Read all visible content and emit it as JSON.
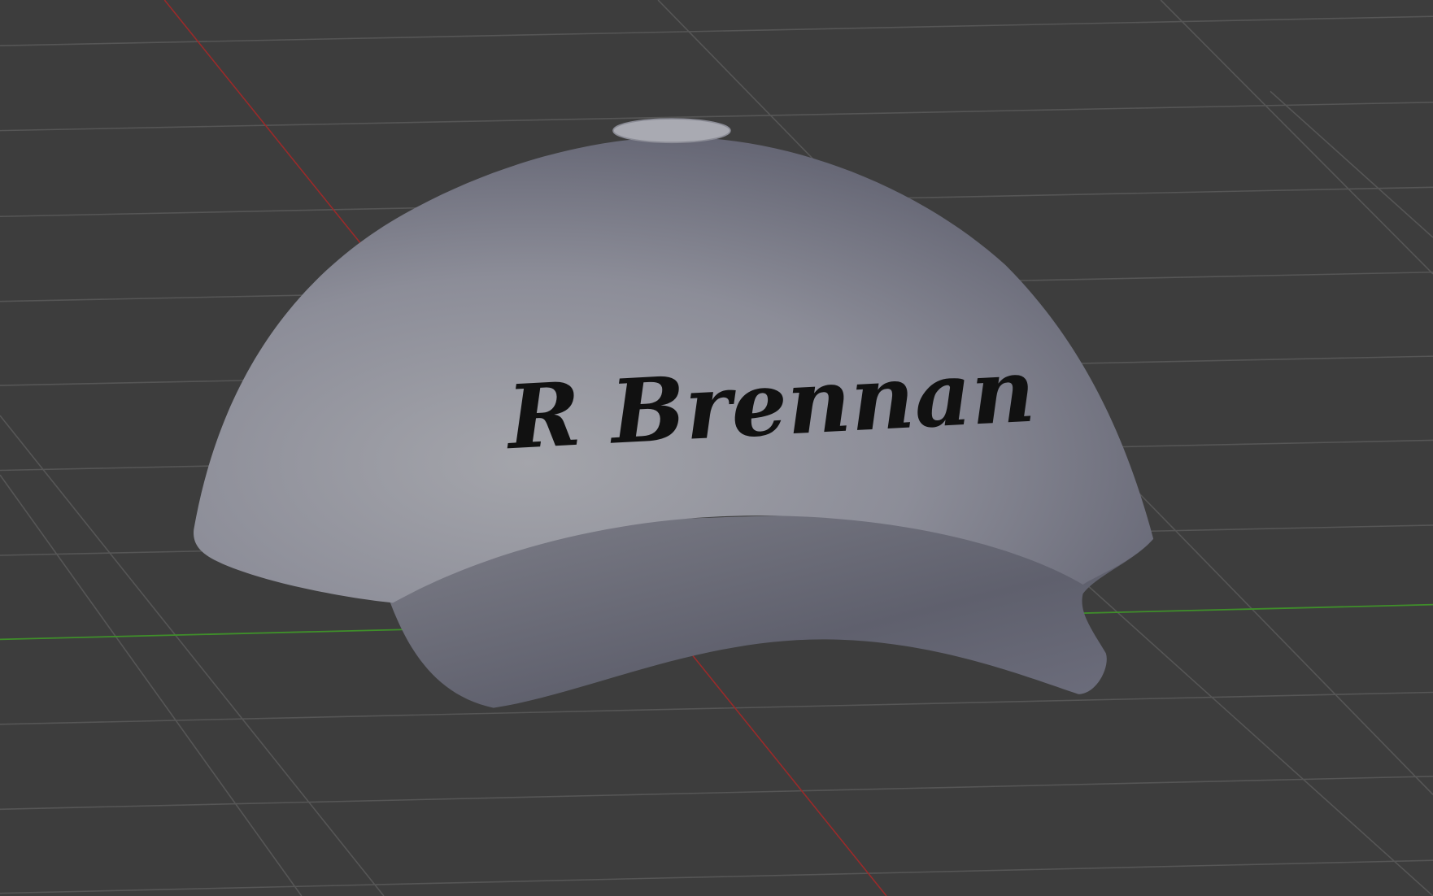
{
  "viewport": {
    "background_color": "#3d3d3d",
    "grid_color": "#555555",
    "x_axis_color": "#9b2a2a",
    "y_axis_color": "#3f8f2a"
  },
  "model": {
    "object": "cap",
    "surface_color": "#8e8f9a",
    "engraved_text": "R Brennan",
    "text_color": "#111111"
  }
}
